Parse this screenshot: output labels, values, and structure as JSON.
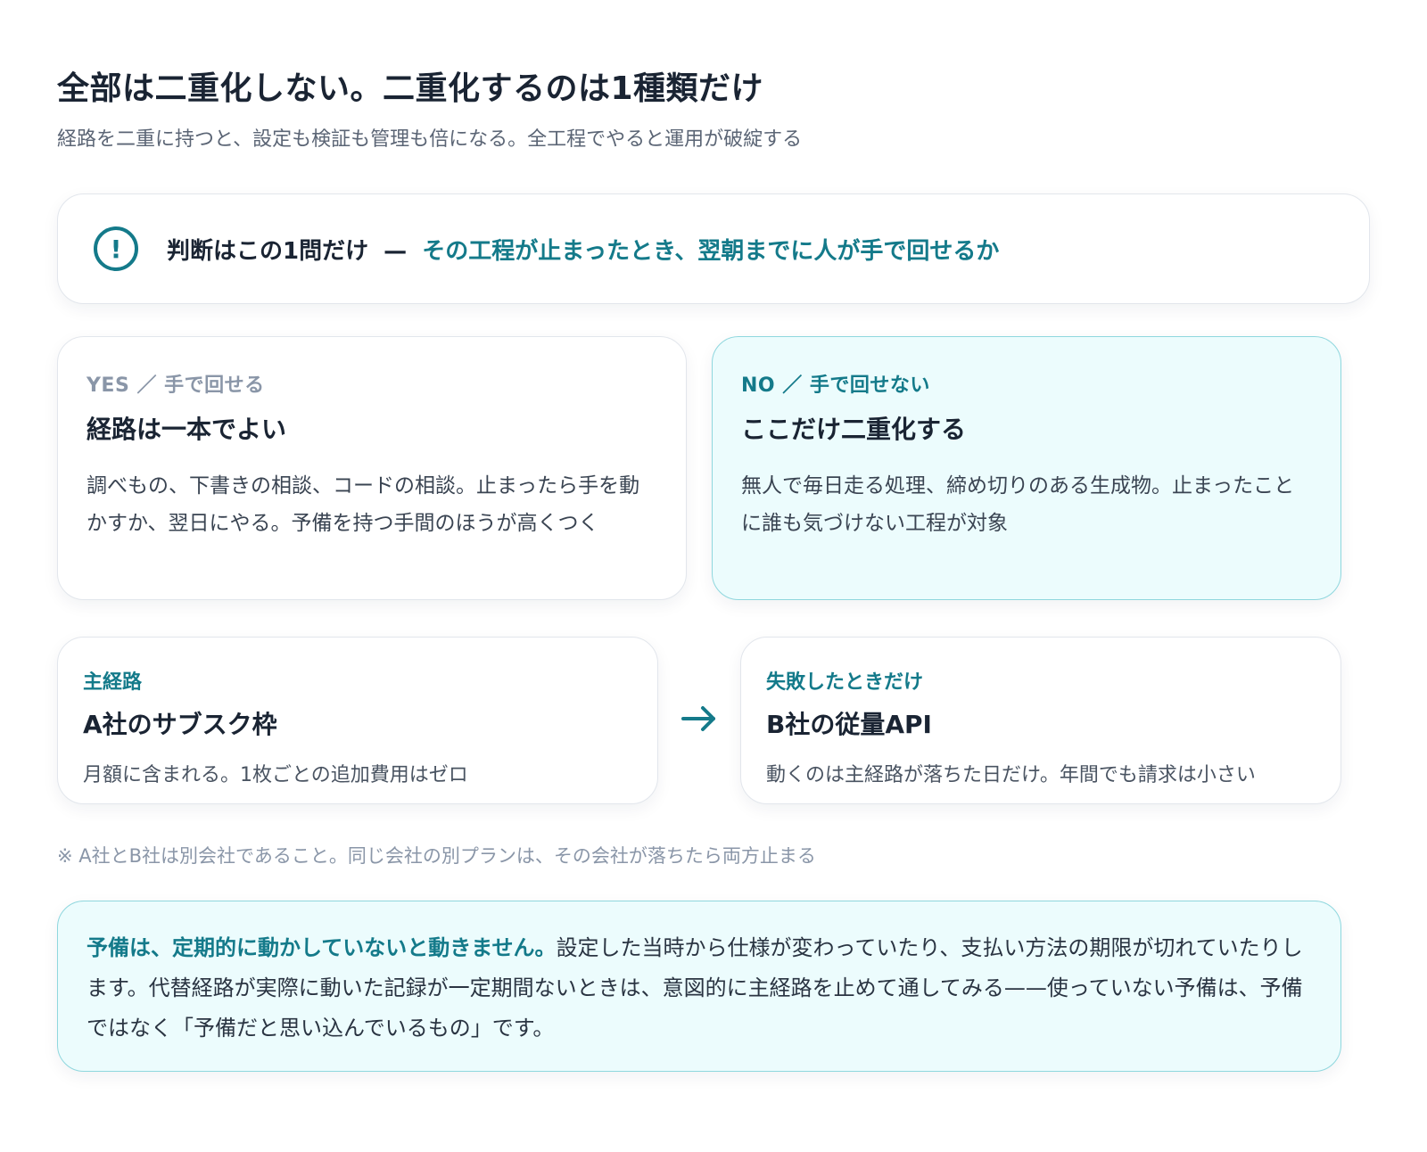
{
  "header": {
    "title": "全部は二重化しない。二重化するのは1種類だけ",
    "subtitle": "経路を二重に持つと、設定も検証も管理も倍になる。全工程でやると運用が破綻する"
  },
  "question": {
    "icon": "alert-circle-icon",
    "lead": "判断はこの1問だけ",
    "separator": "—",
    "highlight": "その工程が止まったとき、翌朝までに人が手で回せるか"
  },
  "yes": {
    "kicker": "YES ／ 手で回せる",
    "heading": "経路は一本でよい",
    "body": "調べもの、下書きの相談、コードの相談。止まったら手を動かすか、翌日にやる。予備を持つ手間のほうが高くつく"
  },
  "no": {
    "kicker": "NO ／ 手で回せない",
    "heading": "ここだけ二重化する",
    "body": "無人で毎日走る処理、締め切りのある生成物。止まったことに誰も気づけない工程が対象"
  },
  "primary_route": {
    "kicker": "主経路",
    "name": "A社のサブスク枠",
    "desc": "月額に含まれる。1枚ごとの追加費用はゼロ"
  },
  "arrow_icon": "arrow-right-icon",
  "fallback_route": {
    "kicker": "失敗したときだけ",
    "name": "B社の従量API",
    "desc": "動くのは主経路が落ちた日だけ。年間でも請求は小さい"
  },
  "note": "※ A社とB社は別会社であること。同じ会社の別プランは、その会社が落ちたら両方止まる",
  "callout": {
    "highlight": "予備は、定期的に動かしていないと動きません。",
    "body": "設定した当時から仕様が変わっていたり、支払い方法の期限が切れていたりします。代替経路が実際に動いた記録が一定期間ないときは、意図的に主経路を止めて通してみる——使っていない予備は、予備ではなく「予備だと思い込んでいるもの」です。"
  },
  "colors": {
    "accent": "#147a8a",
    "accent_bg": "#ecfcfd",
    "accent_border": "#8fd7de",
    "text": "#1a2433",
    "muted": "#8a96a8"
  }
}
